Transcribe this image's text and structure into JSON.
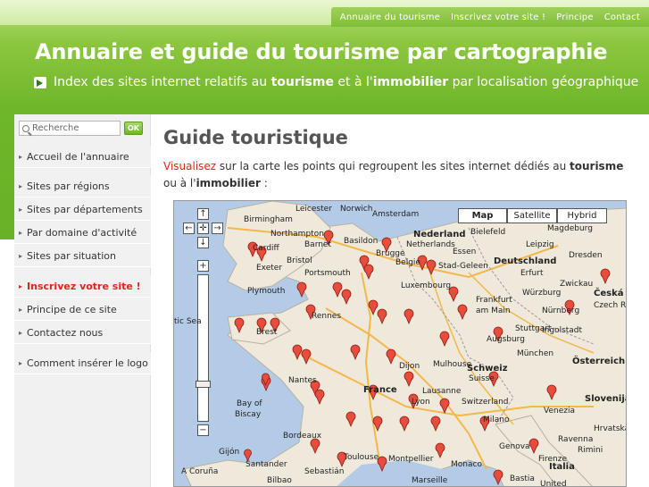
{
  "top_nav": {
    "items": [
      "Annuaire du tourisme",
      "Inscrivez votre site !",
      "Principe",
      "Contact"
    ]
  },
  "header": {
    "title": "Annuaire et guide du tourisme par cartographie",
    "subtitle_prefix": "Index des sites internet relatifs au ",
    "subtitle_b1": "tourisme",
    "subtitle_mid": " et à l'",
    "subtitle_b2": "immobilier",
    "subtitle_suffix": " par localisation géographique"
  },
  "search": {
    "placeholder": "Recherche",
    "ok_label": "OK"
  },
  "sidebar": {
    "items": [
      "Accueil de l'annuaire",
      "Sites par régions",
      "Sites par départements",
      "Par domaine d'activité",
      "Sites par situation",
      "Inscrivez votre site !",
      "Principe de ce site",
      "Contactez nous",
      "Comment insérer le logo"
    ]
  },
  "main": {
    "title": "Guide touristique",
    "intro_link": "Visualisez",
    "intro_1": " sur la carte les points qui regroupent les sites internet dédiés au ",
    "intro_b1": "tourisme",
    "intro_2": " ou à l'",
    "intro_b2": "immobilier",
    "intro_3": " :"
  },
  "map": {
    "types": [
      "Map",
      "Satellite",
      "Hybrid"
    ],
    "labels": [
      "Leicester",
      "Norwich",
      "Birmingham",
      "Amsterdam",
      "Northampton",
      "Nederland",
      "Bielefeld",
      "Magdeburg",
      "Cardiff",
      "Barnet",
      "Basildon",
      "Netherlands",
      "Leipzig",
      "Bristol",
      "Brugge",
      "Essen",
      "Deutschland",
      "Dresden",
      "Exeter",
      "Portsmouth",
      "Belgie",
      "Stad-Geleen",
      "Erfurt",
      "Plymouth",
      "Luxembourg",
      "Frankfurt",
      "Würzburg",
      "Zwickau",
      "Česká Republika",
      "am Main",
      "Nürnberg",
      "Czech Re",
      "tic Sea",
      "Brest",
      "Rennes",
      "Stuttgart",
      "Augsburg",
      "Ingolstadt",
      "München",
      "Nantes",
      "Dijon",
      "Mulhouse",
      "Schweiz",
      "Suisse",
      "Österreich",
      "Lausanne",
      "Slovenija",
      "Bay of",
      "Biscay",
      "France",
      "Lyon",
      "Switzerland",
      "Milano",
      "Venezia",
      "Bordeaux",
      "Genova",
      "Ravenna",
      "Hrvatska",
      "Gijón",
      "Santander",
      "Toulouse",
      "Montpellier",
      "Monaco",
      "Italia",
      "Firenze",
      "A Coruña",
      "Bilbao",
      "Marseille",
      "Rimini",
      "Sebastián",
      "Bastia",
      "United"
    ]
  }
}
